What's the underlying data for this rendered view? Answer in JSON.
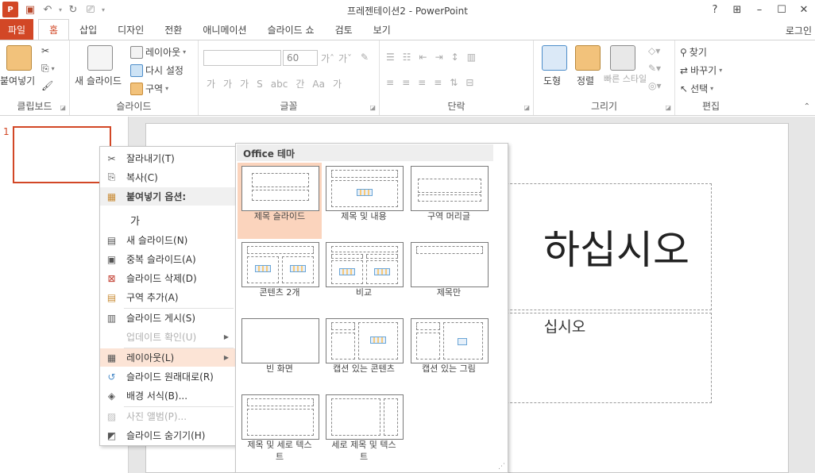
{
  "window": {
    "title": "프레젠테이션2 - PowerPoint",
    "app_logo": "P",
    "login": "로그인",
    "help": "?",
    "ribbon_display": "⊞",
    "minimize": "–",
    "maximize": "☐",
    "close": "✕"
  },
  "tabs": [
    "파일",
    "홈",
    "삽입",
    "디자인",
    "전환",
    "애니메이션",
    "슬라이드 쇼",
    "검토",
    "보기"
  ],
  "ribbon": {
    "clipboard": {
      "label": "클립보드",
      "paste": "붙여넣기"
    },
    "slides": {
      "label": "슬라이드",
      "new_slide": "새 슬라이드",
      "layout": "레이아웃",
      "reset": "다시 설정",
      "section": "구역"
    },
    "font": {
      "label": "글꼴",
      "font_name": "",
      "font_size": "60"
    },
    "paragraph": {
      "label": "단락"
    },
    "drawing": {
      "label": "그리기",
      "shapes": "도형",
      "arrange": "정렬",
      "quick_styles": "빠른 스타일"
    },
    "editing": {
      "label": "편집",
      "find": "찾기",
      "replace": "바꾸기",
      "select": "선택"
    }
  },
  "thumb_pane": {
    "slide_number": "1"
  },
  "slide": {
    "title_fragment": "하십시오",
    "subtitle_fragment": "십시오"
  },
  "context_menu": {
    "cut": "잘라내기(T)",
    "copy": "복사(C)",
    "paste_options": "붙여넣기 옵션:",
    "paste_option_glyph": "가",
    "new_slide": "새 슬라이드(N)",
    "duplicate": "중복 슬라이드(A)",
    "delete": "슬라이드 삭제(D)",
    "add_section": "구역 추가(A)",
    "publish": "슬라이드 게시(S)",
    "check_updates": "업데이트 확인(U)",
    "layout": "레이아웃(L)",
    "reset_slide": "슬라이드 원래대로(R)",
    "format_bg": "배경 서식(B)...",
    "photo_album": "사진 앨범(P)...",
    "hide_slide": "슬라이드 숨기기(H)"
  },
  "gallery": {
    "header": "Office 테마",
    "items": [
      "제목 슬라이드",
      "제목 및 내용",
      "구역 머리글",
      "콘텐츠 2개",
      "비교",
      "제목만",
      "빈 화면",
      "캡션 있는 콘텐츠",
      "캡션 있는 그림",
      "제목 및 세로 텍스트",
      "세로 제목 및 텍스트"
    ]
  },
  "colors": {
    "accent": "#d24726",
    "selection": "#fbd4bd",
    "menu_highlight": "#fce4d6"
  }
}
